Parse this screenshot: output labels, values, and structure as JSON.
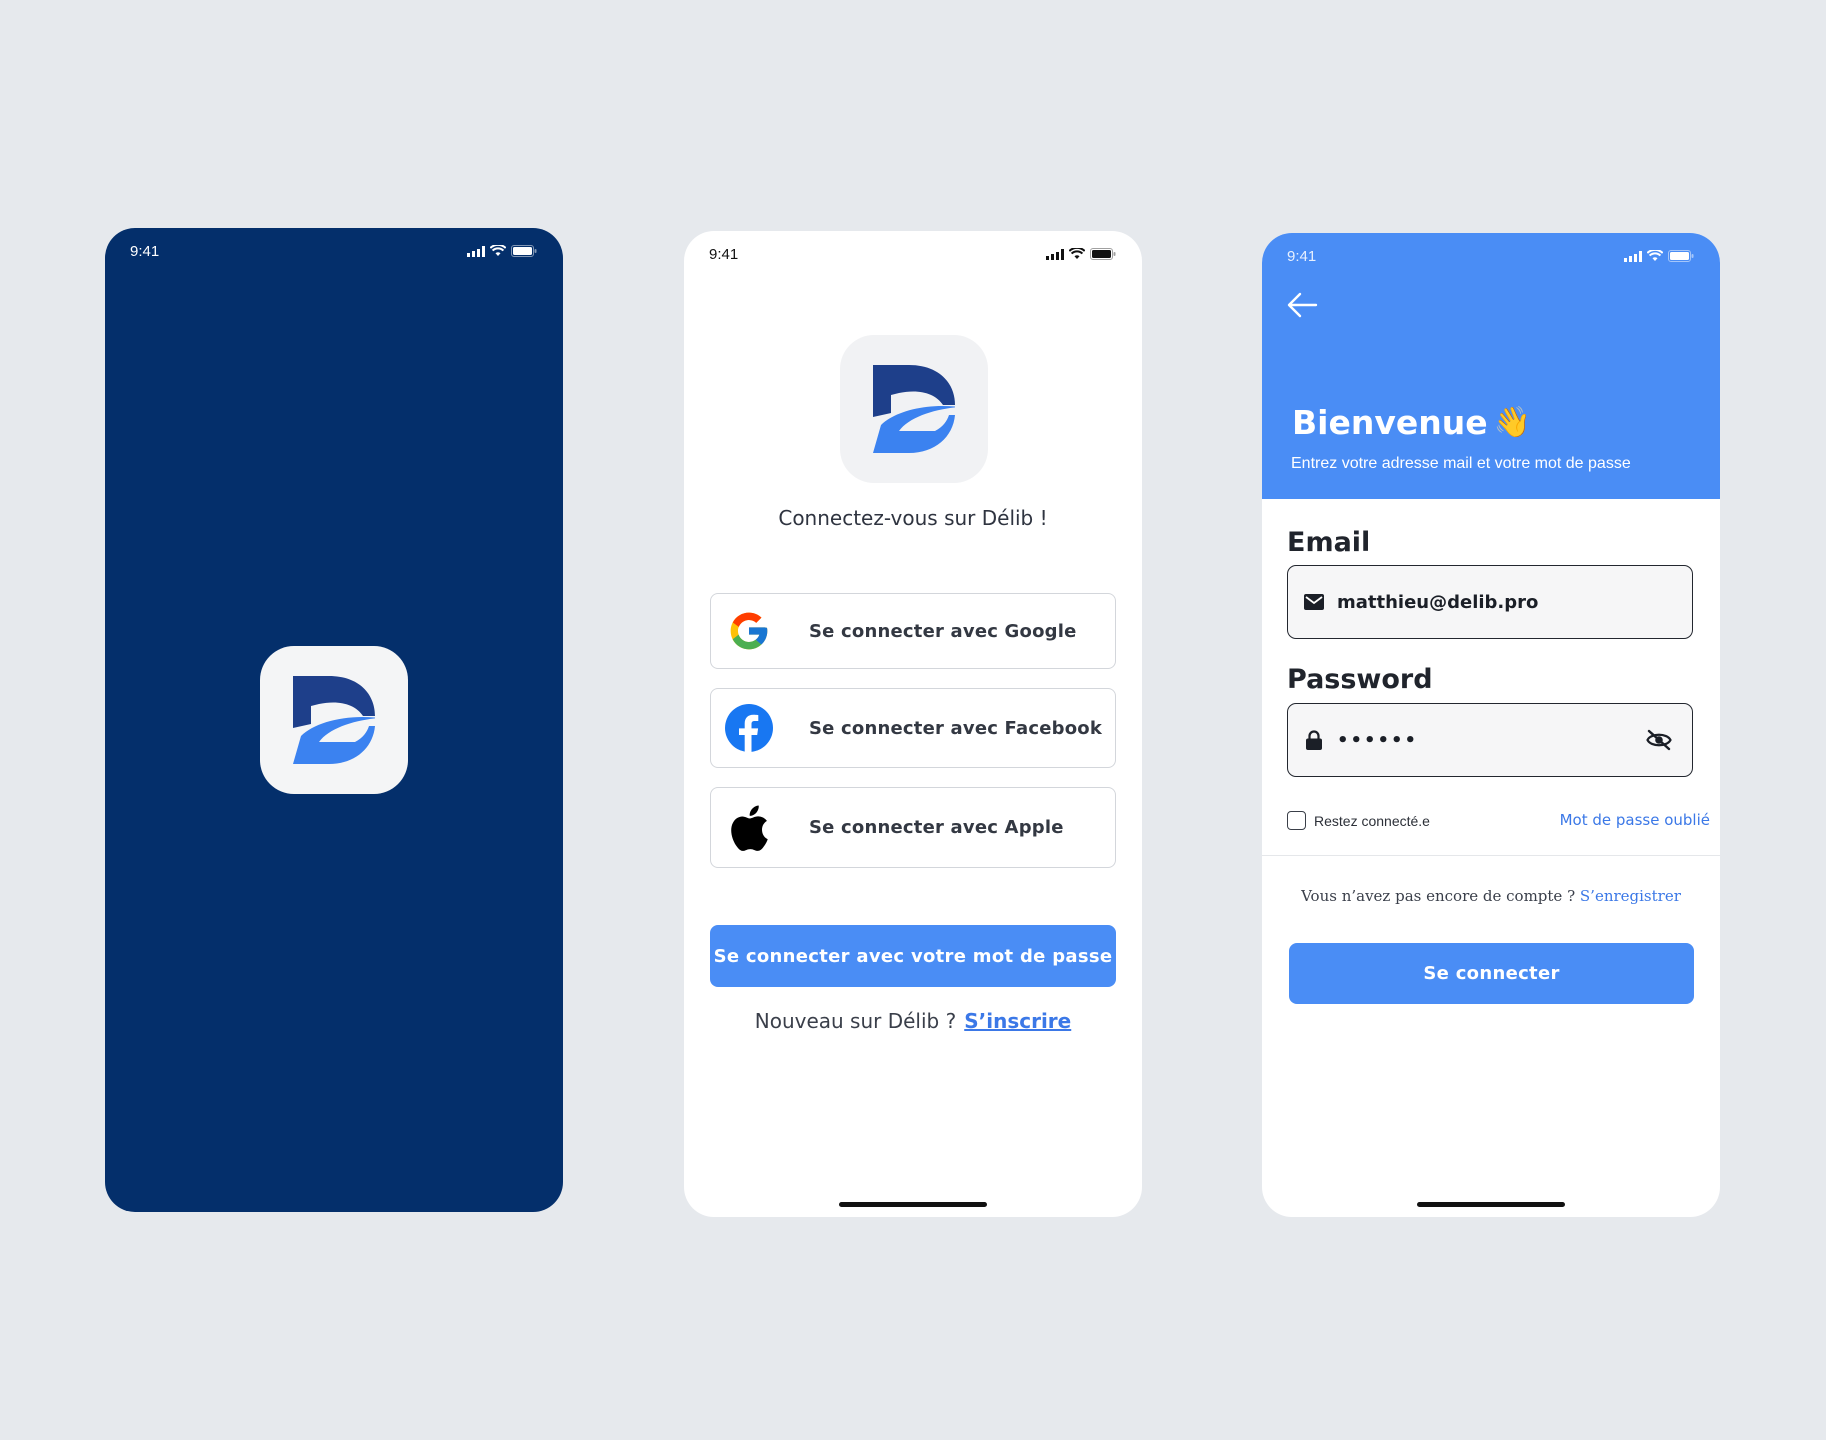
{
  "status_bar": {
    "time": "9:41"
  },
  "colors": {
    "splash_bg": "#042f6b",
    "primary": "#4a8df5",
    "link": "#3b78e7",
    "logo_dark": "#1e3f8a",
    "logo_light": "#3b82f0"
  },
  "splash": {
    "logo_icon": "delib-logo-icon"
  },
  "login_options": {
    "title": "Connectez-vous sur Délib !",
    "google_label": "Se connecter avec Google",
    "facebook_label": "Se connecter avec Facebook",
    "apple_label": "Se connecter avec Apple",
    "password_button": "Se connecter avec votre mot de passe",
    "new_prompt": "Nouveau sur Délib ?",
    "signup_link": "S’inscrire"
  },
  "login_form": {
    "title": "Bienvenue",
    "title_emoji": "👋",
    "subtitle": "Entrez votre adresse mail et votre mot de passe",
    "email_label": "Email",
    "email_value": "matthieu@delib.pro",
    "password_label": "Password",
    "password_value": "••••••",
    "remember_label": "Restez connecté.e",
    "forgot_link": "Mot de passe oublié",
    "no_account_prompt": "Vous n’avez pas encore de compte ?",
    "register_link": "S’enregistrer",
    "submit_label": "Se connecter"
  }
}
